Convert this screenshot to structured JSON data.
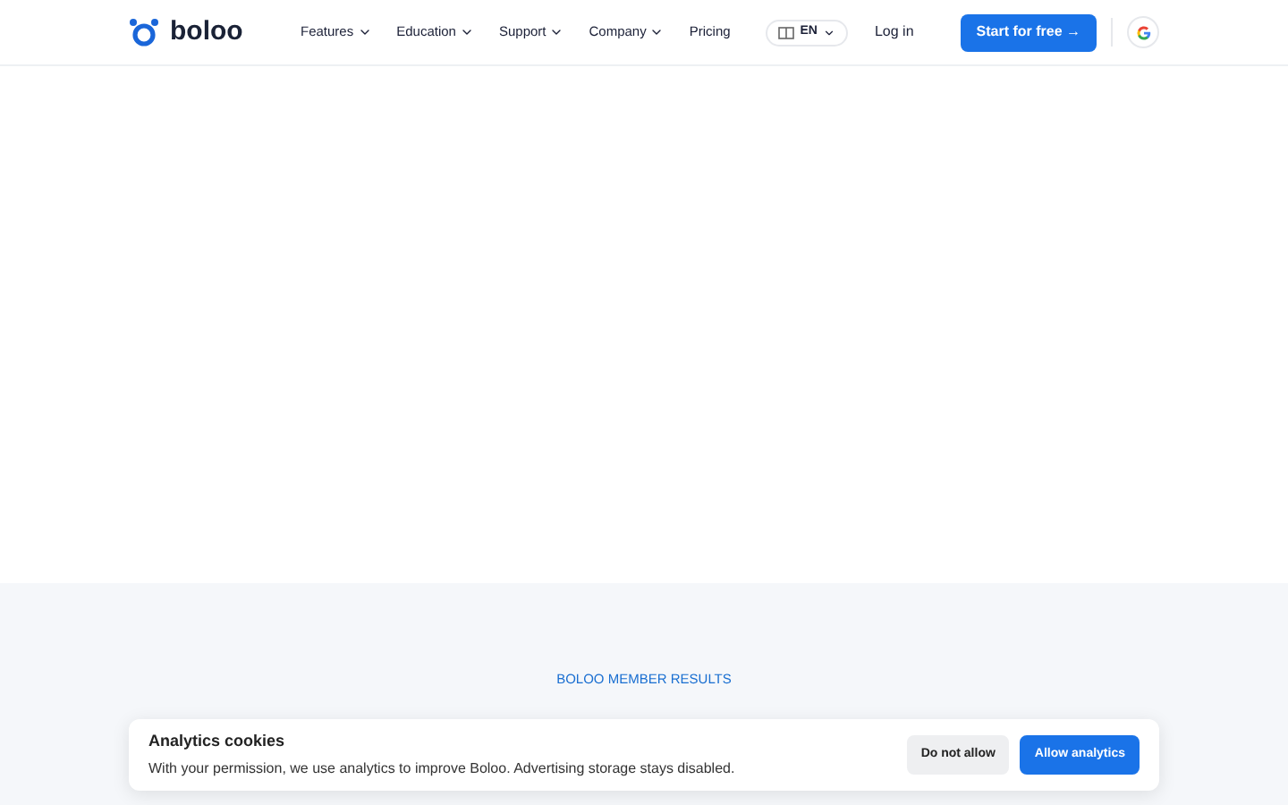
{
  "nav": {
    "logo": "boloo",
    "items": [
      {
        "label": "Features",
        "dropdown": true
      },
      {
        "label": "Education",
        "dropdown": true
      },
      {
        "label": "Support",
        "dropdown": true
      },
      {
        "label": "Company",
        "dropdown": true
      },
      {
        "label": "Pricing",
        "dropdown": false
      }
    ],
    "language": "EN",
    "login": "Log in",
    "cta": "Start for free →"
  },
  "section": {
    "eyebrow": "BOLOO MEMBER RESULTS"
  },
  "cookie_banner": {
    "title": "Analytics cookies",
    "text": "With your permission, we use analytics to improve Boloo. Advertising storage stays disabled.",
    "buttons": [
      {
        "label": "Do not allow",
        "kind": "secondary"
      },
      {
        "label": "Allow analytics",
        "kind": "primary"
      }
    ]
  }
}
